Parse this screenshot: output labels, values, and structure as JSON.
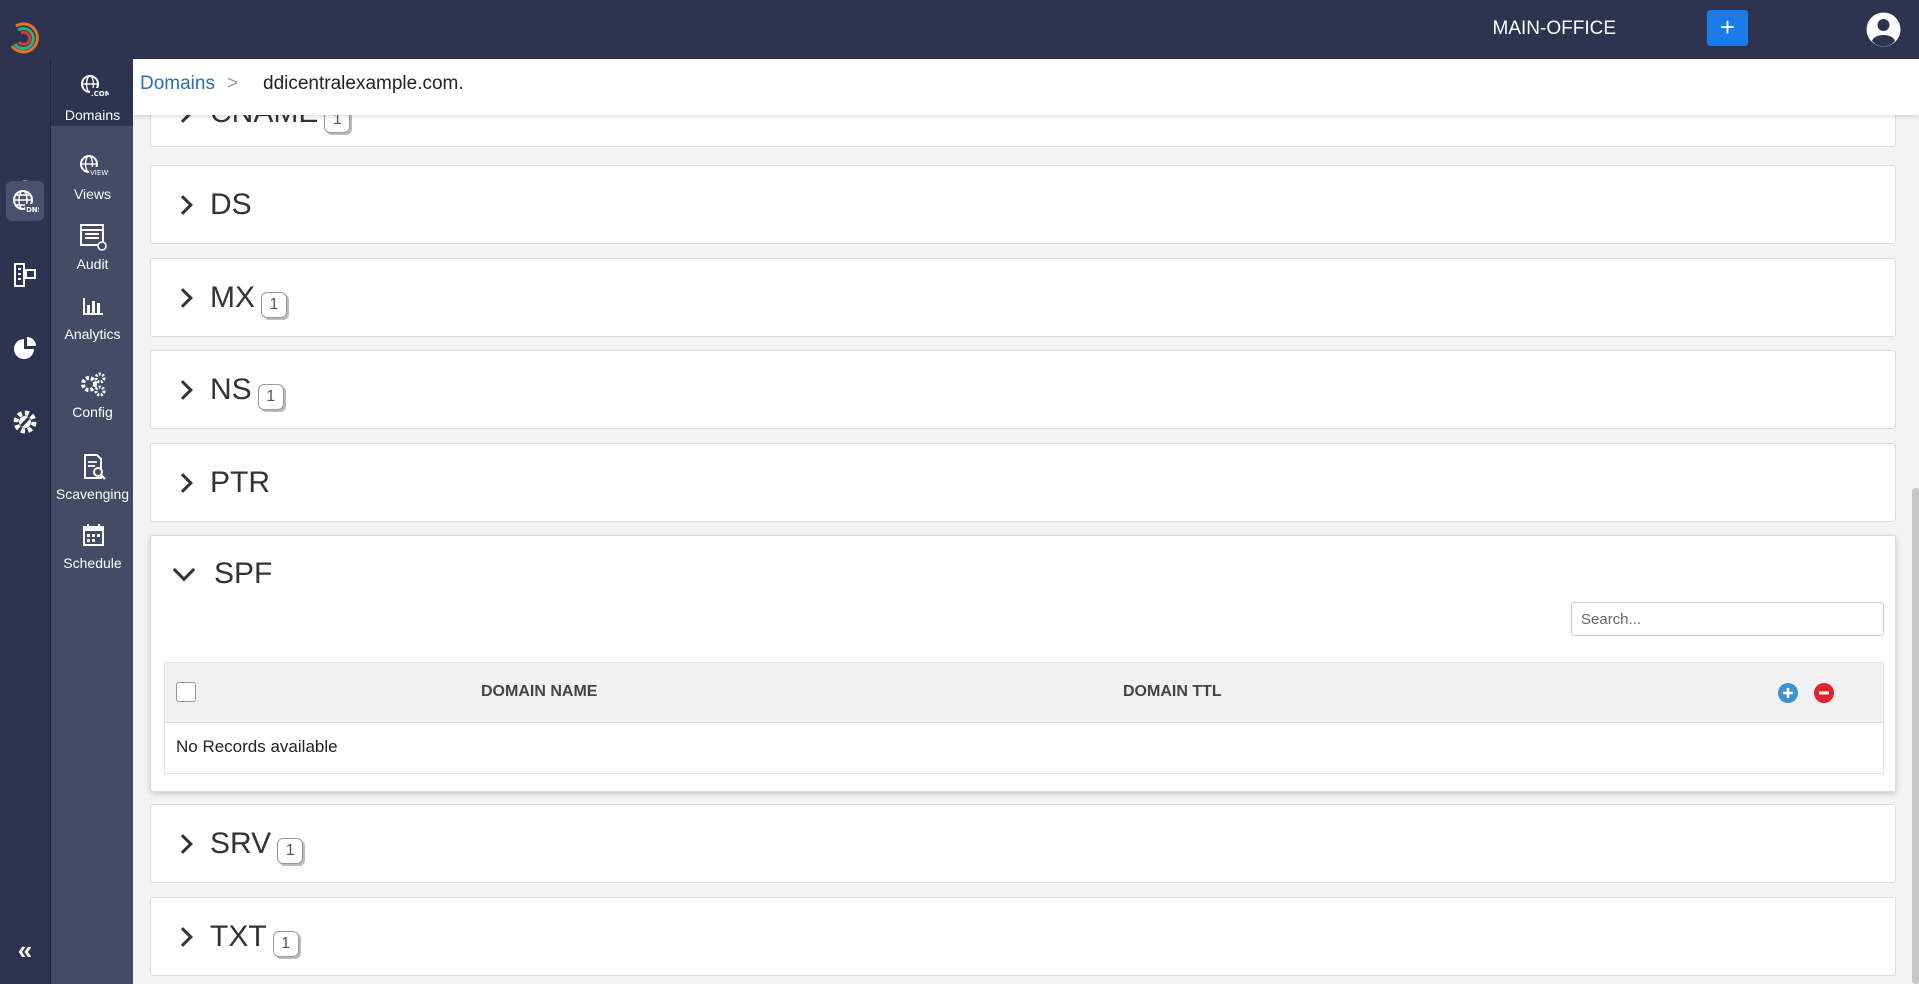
{
  "header": {
    "tenant": "MAIN-OFFICE",
    "add_button": "+"
  },
  "rail": {
    "icons": [
      "dashboard-icon",
      "dns-globe-icon",
      "network-icon",
      "reports-pie-icon",
      "settings-wrench-icon"
    ],
    "collapse": "«"
  },
  "submenu": {
    "items": [
      {
        "label": "Domains",
        "icon": "domains-globe-icon"
      },
      {
        "label": "Views",
        "icon": "views-globe-icon"
      },
      {
        "label": "Audit",
        "icon": "audit-icon"
      },
      {
        "label": "Analytics",
        "icon": "analytics-icon"
      },
      {
        "label": "Config",
        "icon": "config-gears-icon"
      },
      {
        "label": "Scavenging",
        "icon": "scavenging-icon"
      },
      {
        "label": "Schedule",
        "icon": "calendar-icon"
      }
    ]
  },
  "breadcrumb": {
    "root": "Domains",
    "separator": ">",
    "current": "ddicentralexample.com."
  },
  "records": [
    {
      "label": "CNAME",
      "badge": "1"
    },
    {
      "label": "DS",
      "badge": ""
    },
    {
      "label": "MX",
      "badge": "1"
    },
    {
      "label": "NS",
      "badge": "1"
    },
    {
      "label": "PTR",
      "badge": ""
    },
    {
      "label": "SPF",
      "badge": ""
    },
    {
      "label": "SRV",
      "badge": "1"
    },
    {
      "label": "TXT",
      "badge": "1"
    }
  ],
  "spf_table": {
    "search_placeholder": "Search...",
    "columns": [
      "DOMAIN NAME",
      "DOMAIN TTL"
    ],
    "empty_text": "No Records available"
  },
  "colors": {
    "topbar": "#2e3450",
    "submenu": "#454b65",
    "primary": "#1b7ce8",
    "link": "#2a6fb4",
    "add": "#3d8fd6",
    "delete": "#e0232e"
  }
}
